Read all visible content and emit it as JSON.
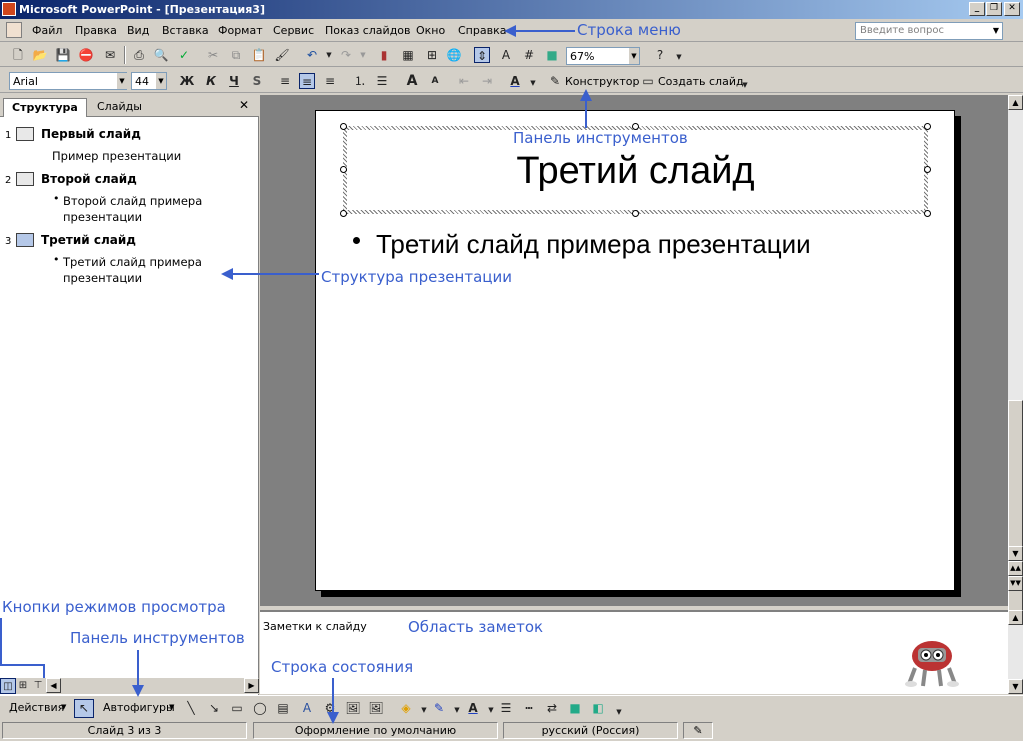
{
  "window": {
    "title": "Microsoft PowerPoint - [Презентация3]"
  },
  "menu": {
    "items": [
      "Файл",
      "Правка",
      "Вид",
      "Вставка",
      "Формат",
      "Сервис",
      "Показ слайдов",
      "Окно",
      "Справка"
    ],
    "ask_placeholder": "Введите вопрос"
  },
  "standard_toolbar": {
    "zoom": "67%"
  },
  "format_toolbar": {
    "font": "Arial",
    "size": "44",
    "bold": "Ж",
    "italic": "К",
    "underline": "Ч",
    "shadow": "S",
    "designer": "Конструктор",
    "new_slide": "Создать слайд"
  },
  "left_pane": {
    "tabs": [
      "Структура",
      "Слайды"
    ],
    "close": "✕",
    "outline": [
      {
        "num": "1",
        "title": "Первый слайд",
        "lines": [
          "Пример презентации"
        ],
        "bullet": false
      },
      {
        "num": "2",
        "title": "Второй слайд",
        "lines": [
          "Второй слайд примера",
          "презентации"
        ],
        "bullet": true
      },
      {
        "num": "3",
        "title": "Третий слайд",
        "lines": [
          "Третий слайд примера",
          "презентации"
        ],
        "bullet": true
      }
    ]
  },
  "slide": {
    "title": "Третий слайд",
    "bullet": "Третий слайд примера презентации"
  },
  "notes": {
    "placeholder": "Заметки к слайду"
  },
  "drawing_toolbar": {
    "actions": "Действия",
    "autoshapes": "Автофигуры"
  },
  "status": {
    "slide": "Слайд 3 из 3",
    "design": "Оформление по умолчанию",
    "language": "русский (Россия)"
  },
  "annotations": {
    "menu_bar": "Строка меню",
    "toolbar_top": "Панель инструментов",
    "outline": "Структура презентации",
    "view_buttons": "Кнопки режимов просмотра",
    "toolbar_bottom": "Панель инструментов",
    "notes_area": "Область заметок",
    "status_bar": "Строка состояния"
  },
  "colors": {
    "annotation": "#3a5fcd",
    "title_bar_start": "#0a246a",
    "title_bar_end": "#a6caf0"
  }
}
